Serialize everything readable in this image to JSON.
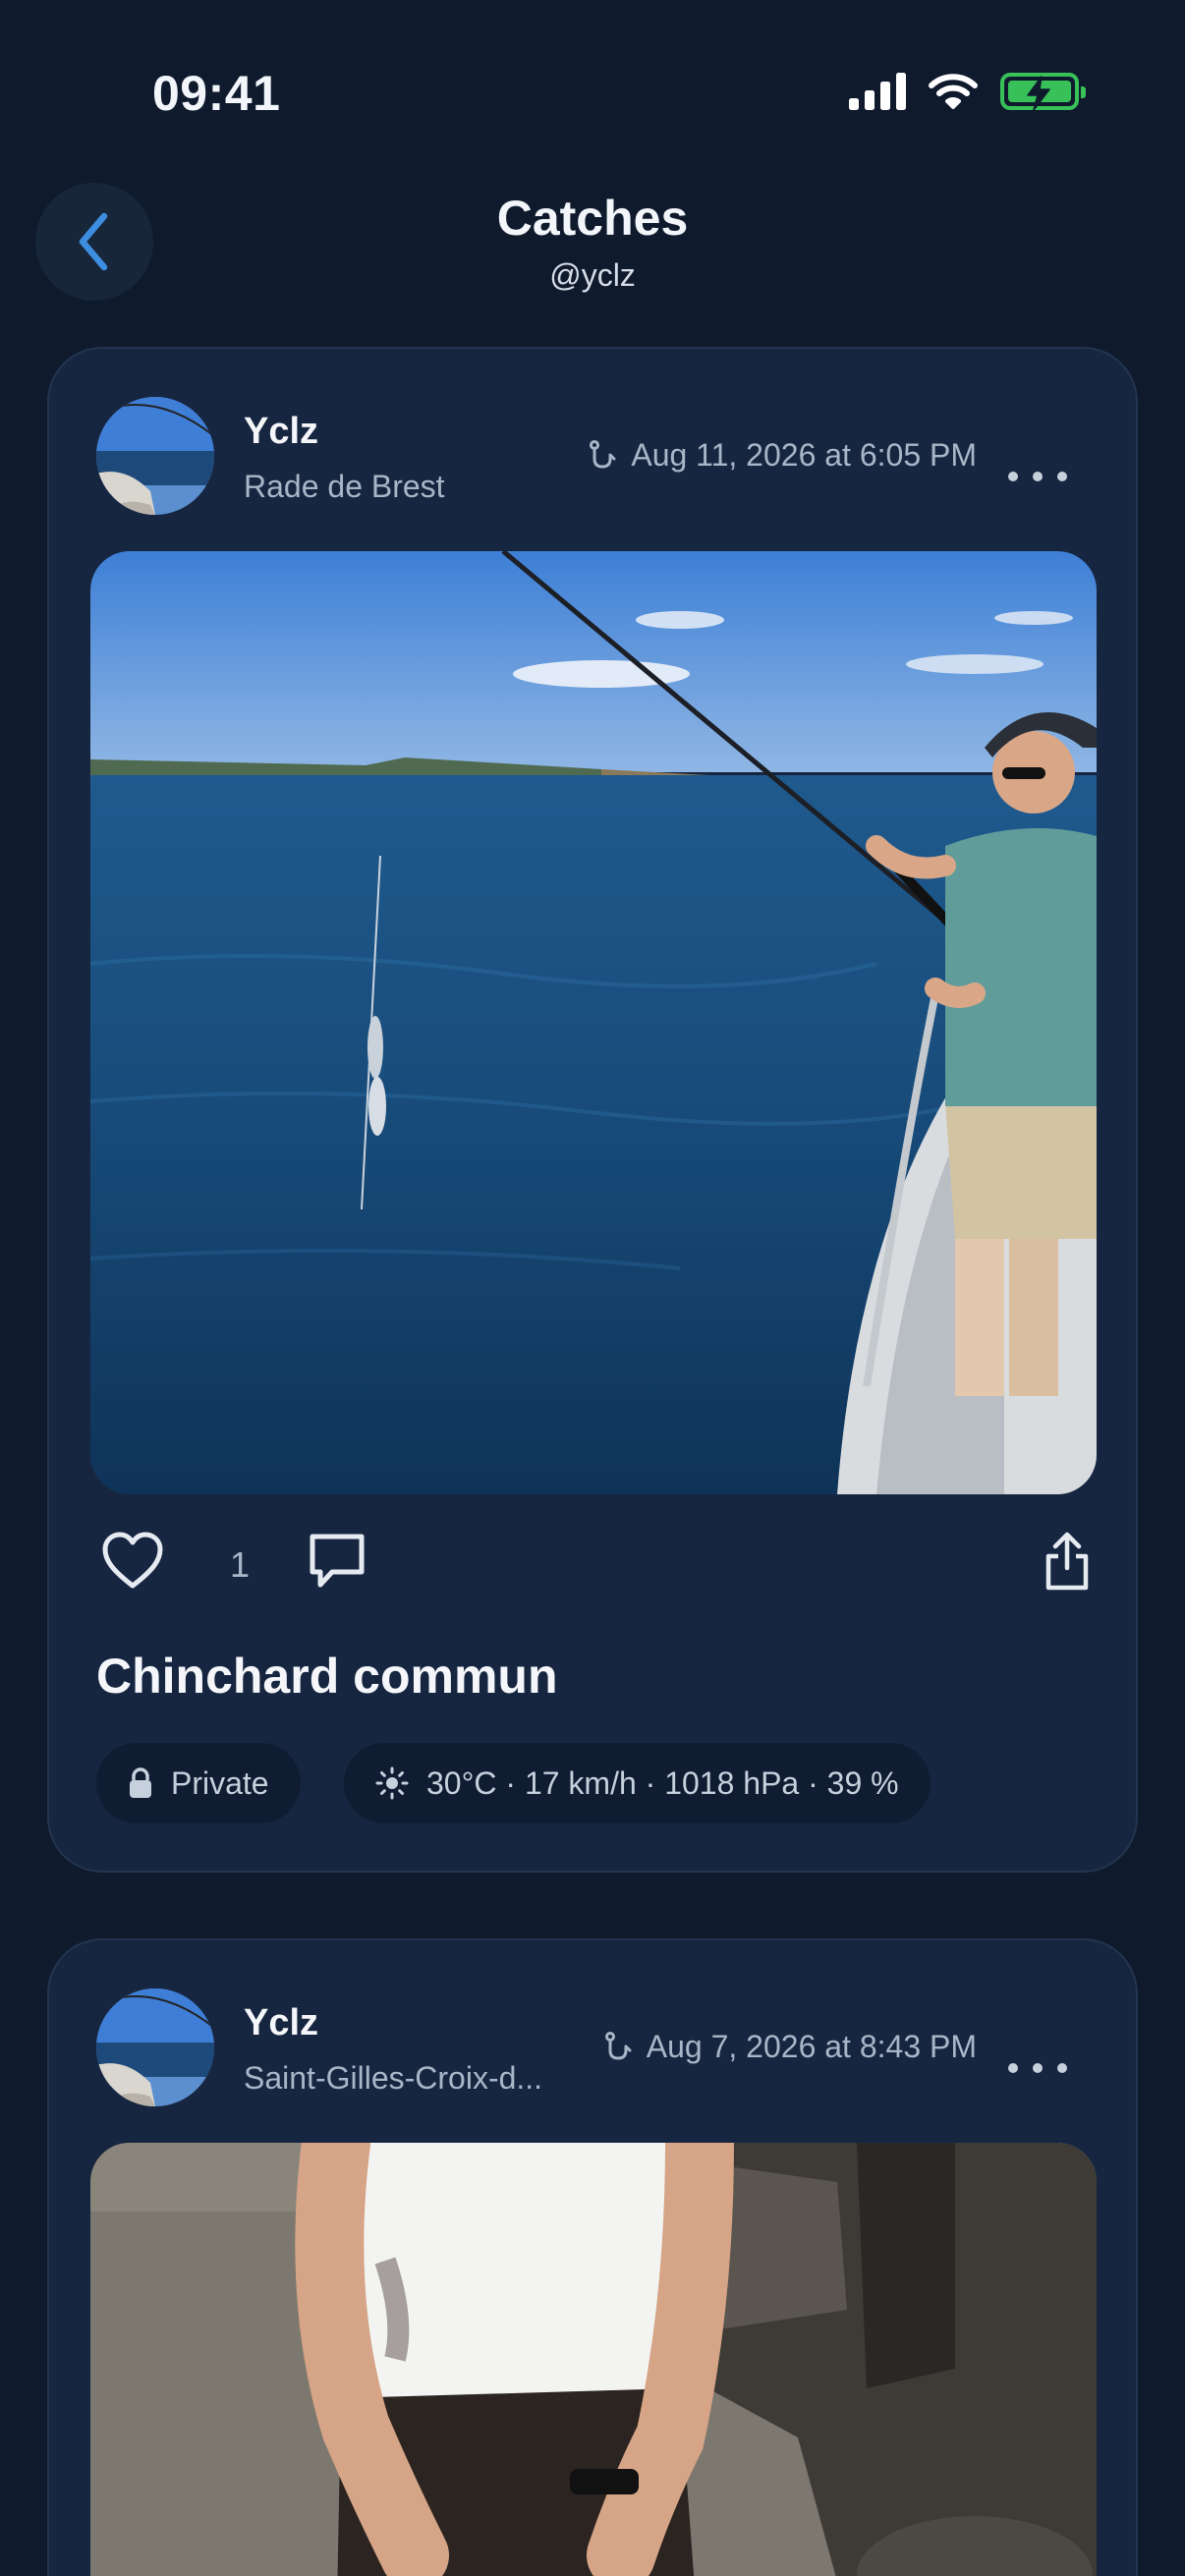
{
  "status_bar": {
    "time": "09:41"
  },
  "header": {
    "title": "Catches",
    "subtitle": "@yclz"
  },
  "posts": [
    {
      "author": "Yclz",
      "location": "Rade de Brest",
      "date": "Aug 11, 2026 at 6:05 PM",
      "likes": "1",
      "species": "Chinchard commun",
      "visibility": "Private",
      "weather": "30°C · 17 km/h · 1018 hPa · 39 %"
    },
    {
      "author": "Yclz",
      "location": "Saint-Gilles-Croix-d...",
      "date": "Aug 7, 2026 at 8:43 PM"
    }
  ],
  "icons": {
    "back": "chevron-left-icon",
    "catch": "fishing-hook-icon",
    "more": "more-horizontal-icon",
    "like": "heart-icon",
    "comment": "comment-icon",
    "share": "share-icon",
    "privacy": "lock-icon",
    "weather": "sun-icon"
  },
  "colors": {
    "background": "#0f1b2d",
    "card": "#172640",
    "accent": "#3d8ee0",
    "battery": "#38c059"
  }
}
